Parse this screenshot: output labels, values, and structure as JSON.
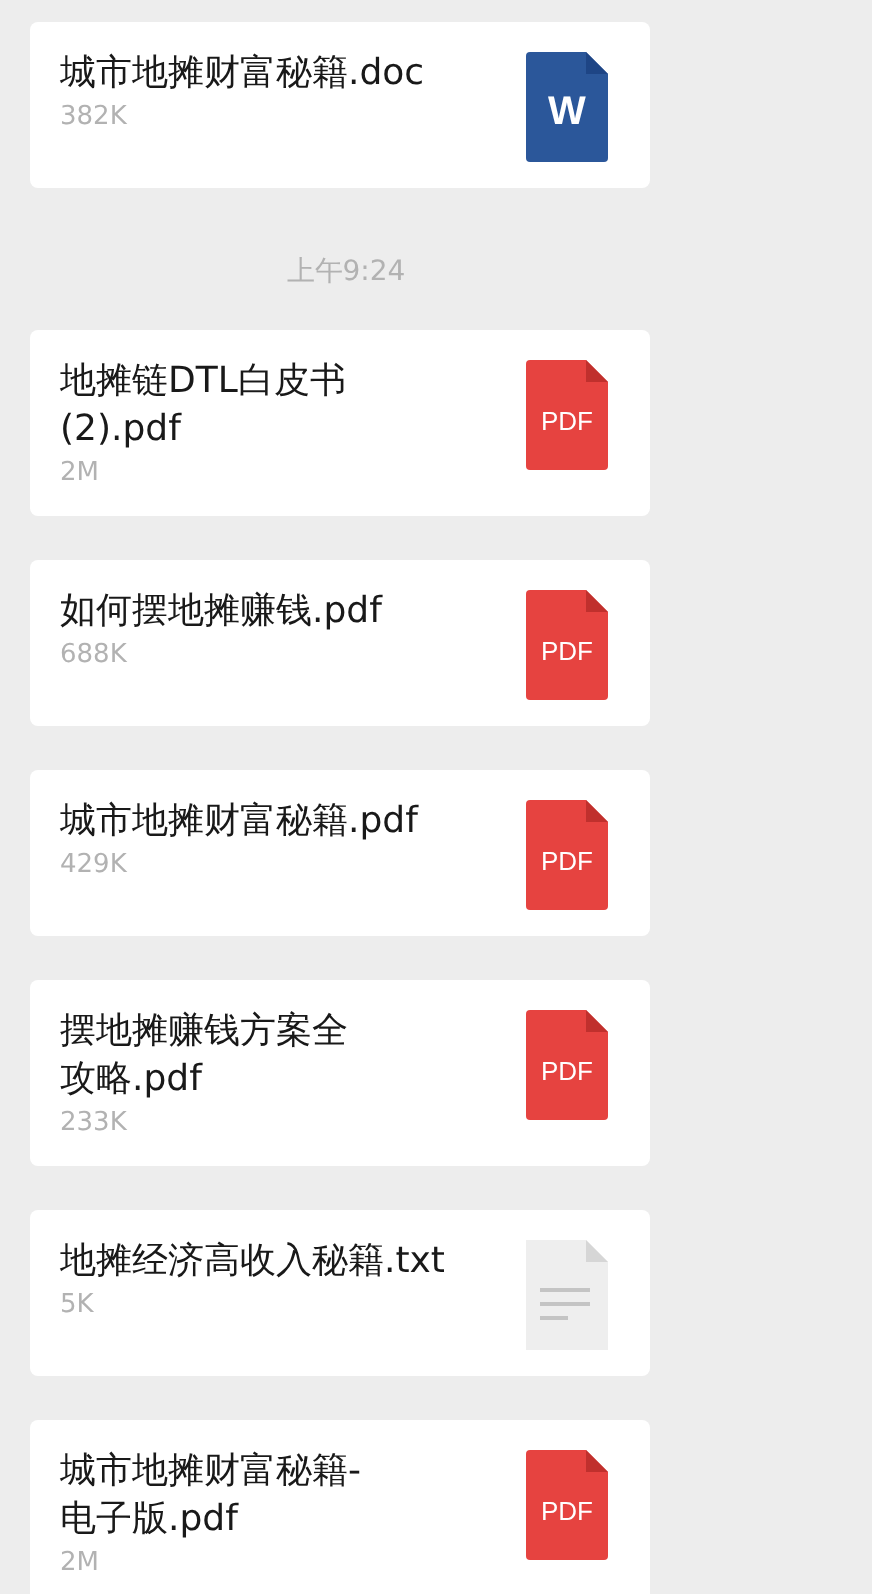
{
  "messages": [
    {
      "kind": "file",
      "name_lines": [
        "城市地摊财富秘籍.doc"
      ],
      "size": "382K",
      "icon": {
        "kind": "word",
        "label": "W"
      }
    },
    {
      "kind": "time",
      "text": "上午9:24"
    },
    {
      "kind": "file",
      "name_lines": [
        "地摊链DTL白皮书",
        "(2).pdf"
      ],
      "size": "2M",
      "icon": {
        "kind": "pdf",
        "label": "PDF"
      }
    },
    {
      "kind": "file",
      "name_lines": [
        "如何摆地摊赚钱.pdf"
      ],
      "size": "688K",
      "icon": {
        "kind": "pdf",
        "label": "PDF"
      }
    },
    {
      "kind": "file",
      "name_lines": [
        "城市地摊财富秘籍.pdf"
      ],
      "size": "429K",
      "icon": {
        "kind": "pdf",
        "label": "PDF"
      }
    },
    {
      "kind": "file",
      "name_lines": [
        "摆地摊赚钱方案全",
        "攻略.pdf"
      ],
      "size": "233K",
      "icon": {
        "kind": "pdf",
        "label": "PDF"
      }
    },
    {
      "kind": "file",
      "name_lines": [
        "地摊经济高收入秘籍.txt"
      ],
      "size": "5K",
      "icon": {
        "kind": "text"
      }
    },
    {
      "kind": "file",
      "name_lines": [
        "城市地摊财富秘籍-",
        "电子版.pdf"
      ],
      "size": "2M",
      "icon": {
        "kind": "pdf",
        "label": "PDF"
      }
    }
  ]
}
